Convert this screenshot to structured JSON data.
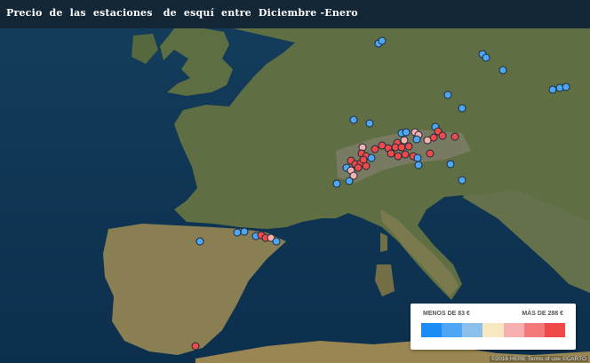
{
  "title": "Precio  de  las  estaciones   de  esquí  entre  Diciembre -Enero",
  "legend": {
    "low_label": "MENOS DE 83 €",
    "high_label": "MÁS DE 288 €",
    "colors": [
      "#1a8cf5",
      "#4ea6f5",
      "#8cc0ec",
      "#f7e8c0",
      "#f6b0b0",
      "#f27a7a",
      "#ee4a4a"
    ]
  },
  "attribution": "©2016 HERE Terms of use  ©CARTO",
  "colors": {
    "sea": "#0f3b5c",
    "land": "#5a6a3e",
    "marker_outline": "#1b2a3a"
  }
}
